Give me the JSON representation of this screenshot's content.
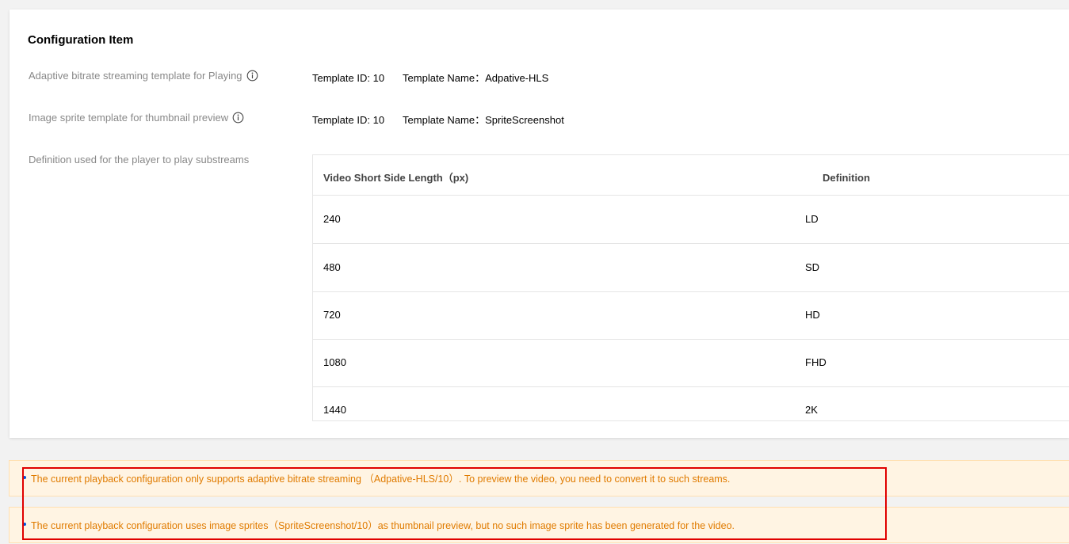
{
  "card": {
    "title": "Configuration Item",
    "rows": [
      {
        "label": "Adaptive bitrate streaming template for Playing",
        "template_id": "Template ID: 10",
        "template_name": "Template Name：Adpative-HLS"
      },
      {
        "label": "Image sprite template for thumbnail preview",
        "template_id": "Template ID: 10",
        "template_name": "Template Name：SpriteScreenshot"
      }
    ],
    "definition_label": "Definition used for the player to play substreams"
  },
  "table": {
    "headers": [
      "Video Short Side Length（px)",
      "Definition"
    ],
    "rows": [
      [
        "240",
        "LD"
      ],
      [
        "480",
        "SD"
      ],
      [
        "720",
        "HD"
      ],
      [
        "1080",
        "FHD"
      ],
      [
        "1440",
        "2K"
      ]
    ]
  },
  "notices": [
    "The current playback configuration only supports adaptive bitrate streaming （Adpative-HLS/10）. To preview the video, you need to convert it to such streams.",
    "The current playback configuration uses image sprites（SpriteScreenshot/10）as thumbnail preview, but no such image sprite has been generated for the video."
  ],
  "colors": {
    "notice_bg": "#fff4e3",
    "notice_text": "#e07b00",
    "highlight": "#e00000"
  },
  "icons": {
    "info": "info-circle-icon"
  }
}
